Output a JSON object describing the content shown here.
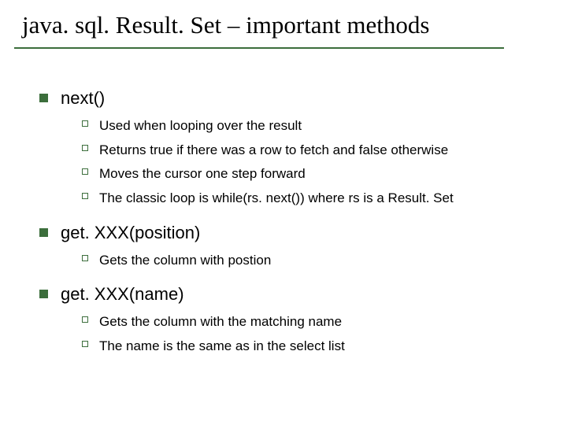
{
  "title": "java. sql. Result. Set – important methods",
  "items": [
    {
      "label": "next()",
      "sub": [
        "Used when looping over the result",
        "Returns true if there was a row to fetch and false otherwise",
        "Moves the cursor one step forward",
        "The classic loop is while(rs. next()) where rs is a Result. Set"
      ]
    },
    {
      "label": "get. XXX(position)",
      "sub": [
        "Gets the column with postion"
      ]
    },
    {
      "label": "get. XXX(name)",
      "sub": [
        "Gets the column with the matching name",
        "The name is the same as in the select list"
      ]
    }
  ]
}
